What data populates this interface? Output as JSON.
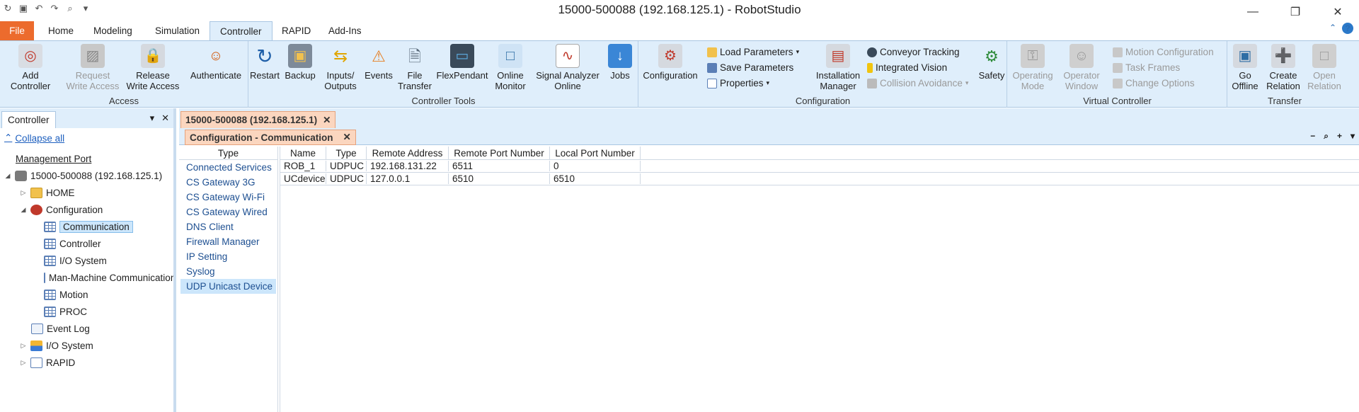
{
  "window": {
    "title": "15000-500088 (192.168.125.1) - RobotStudio"
  },
  "ribbon_tabs": [
    "File",
    "Home",
    "Modeling",
    "Simulation",
    "Controller",
    "RAPID",
    "Add-Ins"
  ],
  "ribbon": {
    "access": {
      "label": "Access",
      "add_controller": [
        "Add",
        "Controller"
      ],
      "request_write": [
        "Request",
        "Write Access"
      ],
      "release_write": [
        "Release",
        "Write Access"
      ],
      "authenticate": [
        "Authenticate",
        ""
      ]
    },
    "tools": {
      "label": "Controller Tools",
      "restart": "Restart",
      "backup": "Backup",
      "inputs_outputs": [
        "Inputs/",
        "Outputs"
      ],
      "events": "Events",
      "file_transfer": [
        "File",
        "Transfer"
      ],
      "flexpendant": "FlexPendant",
      "online_monitor": [
        "Online",
        "Monitor"
      ],
      "signal_analyzer": [
        "Signal Analyzer",
        "Online"
      ],
      "jobs": "Jobs"
    },
    "configuration": {
      "label": "Configuration",
      "configuration": "Configuration",
      "load_parameters": "Load Parameters",
      "save_parameters": "Save Parameters",
      "properties": "Properties",
      "installation_manager": [
        "Installation",
        "Manager"
      ],
      "conveyor_tracking": "Conveyor Tracking",
      "integrated_vision": "Integrated Vision",
      "collision_avoidance": "Collision Avoidance",
      "safety": "Safety"
    },
    "virtual": {
      "label": "Virtual Controller",
      "operating_mode": [
        "Operating",
        "Mode"
      ],
      "operator_window": [
        "Operator",
        "Window"
      ],
      "motion_configuration": "Motion Configuration",
      "task_frames": "Task Frames",
      "change_options": "Change Options"
    },
    "transfer": {
      "label": "Transfer",
      "go_offline": [
        "Go",
        "Offline"
      ],
      "create_relation": [
        "Create",
        "Relation"
      ],
      "open_relation": [
        "Open",
        "Relation"
      ]
    }
  },
  "left_panel": {
    "title": "Controller",
    "collapse_all": "Collapse all",
    "tree": {
      "management_port": "Management Port",
      "controller": "15000-500088 (192.168.125.1)",
      "home": "HOME",
      "configuration": "Configuration",
      "communication": "Communication",
      "controller_topic": "Controller",
      "io_system_topic": "I/O System",
      "mmc": "Man-Machine Communication",
      "motion": "Motion",
      "proc": "PROC",
      "event_log": "Event Log",
      "io_system": "I/O System",
      "rapid": "RAPID"
    }
  },
  "document": {
    "tab": "15000-500088 (192.168.125.1)",
    "subtab": "Configuration - Communication",
    "type_header": "Type",
    "types": [
      "Connected Services",
      "CS Gateway 3G",
      "CS Gateway Wi-Fi",
      "CS Gateway Wired",
      "DNS Client",
      "Firewall Manager",
      "IP Setting",
      "Syslog",
      "UDP Unicast Device"
    ],
    "selected_type": "UDP Unicast Device",
    "columns": [
      "Name",
      "Type",
      "Remote Address",
      "Remote Port Number",
      "Local Port Number"
    ],
    "rows": [
      [
        "ROB_1",
        "UDPUC",
        "192.168.131.22",
        "6511",
        "0"
      ],
      [
        "UCdevice",
        "UDPUC",
        "127.0.0.1",
        "6510",
        "6510"
      ]
    ]
  }
}
